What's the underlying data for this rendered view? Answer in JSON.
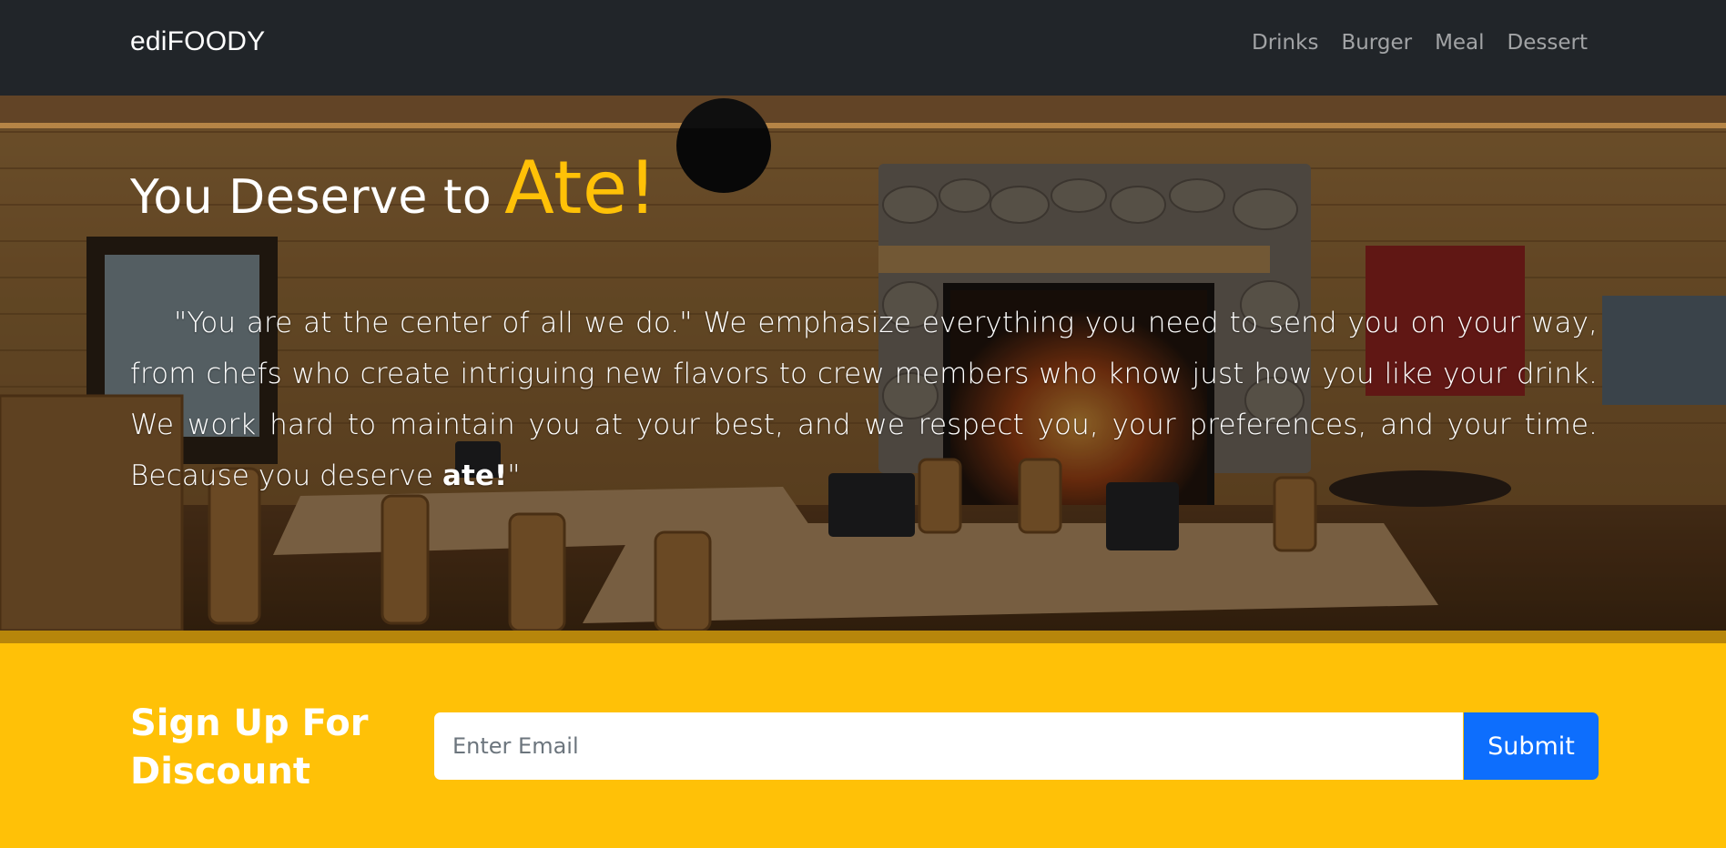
{
  "navbar": {
    "brand": "ediFOODY",
    "links": [
      "Drinks",
      "Burger",
      "Meal",
      "Dessert"
    ]
  },
  "hero": {
    "title_prefix": "You Deserve to",
    "title_accent": "Ate!",
    "paragraph_main": "\"You are at the center of all we do.\" We emphasize everything you need to send you on your way, from chefs who create intriguing new flavors to crew members who know just how you like your drink. We work hard to maintain you at your best, and we respect you, your preferences, and your time. Because you deserve ",
    "paragraph_bold": "ate!",
    "paragraph_end": "\""
  },
  "signup": {
    "title": "Sign Up For Discount",
    "email_placeholder": "Enter Email",
    "submit_label": "Submit"
  },
  "colors": {
    "navbar_bg": "#212529",
    "accent": "#ffc107",
    "button": "#0d6efd"
  }
}
